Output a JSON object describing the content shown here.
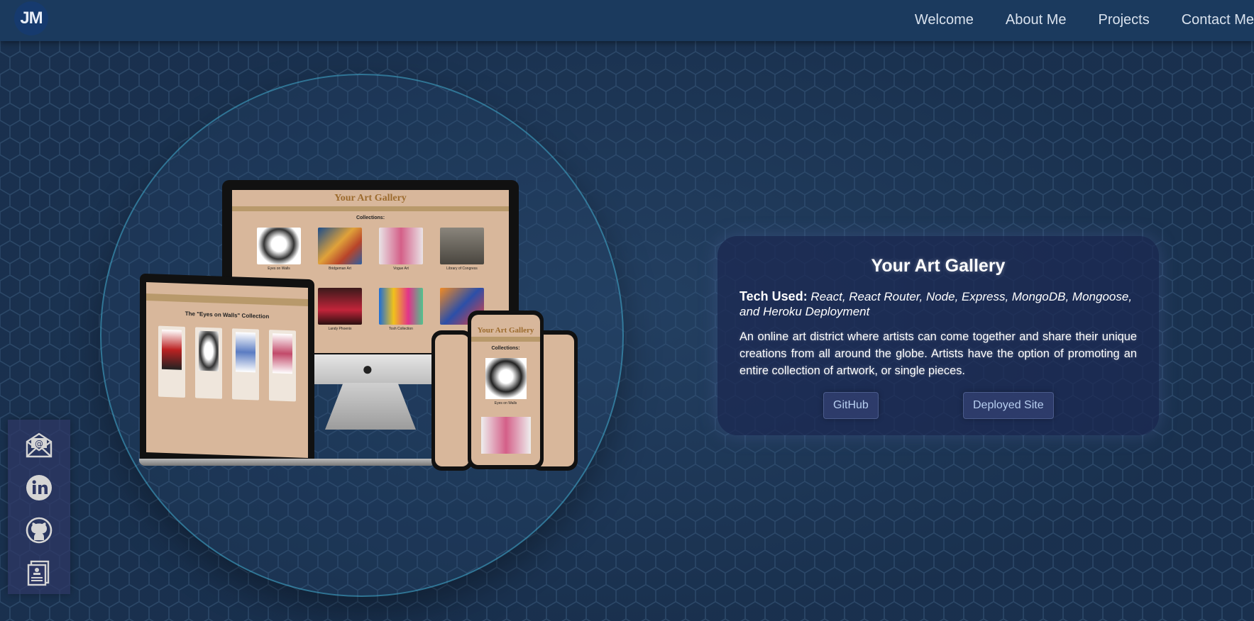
{
  "nav": {
    "logo_text": "JM",
    "links": [
      "Welcome",
      "About Me",
      "Projects",
      "Contact Me"
    ]
  },
  "project": {
    "title": "Your Art Gallery",
    "tech_label": "Tech Used:",
    "tech_list": "React, React Router, Node, Express, MongoDB, Mongoose, and Heroku Deployment",
    "description": "An online art district where artists can come together and share their unique creations from all around the globe. Artists have the option of promoting an entire collection of artwork, or single pieces.",
    "buttons": {
      "github": "GitHub",
      "deployed": "Deployed Site"
    }
  },
  "mockup": {
    "desktop_title": "Your Art Gallery",
    "desktop_subtitle": "Collections:",
    "collections": [
      "Eyes on Walls",
      "Bridgeman Art",
      "Vogue Art",
      "Library of Congress",
      "",
      "Landy Phoenix",
      "Tosh Collection",
      ""
    ],
    "laptop_title": "The \"Eyes on Walls\" Collection",
    "phone_subtitle": "Collections:",
    "phone_item": "Eyes on Walls"
  },
  "sidebar": {
    "icons": [
      "email-icon",
      "linkedin-icon",
      "github-icon",
      "resume-icon"
    ]
  },
  "colors": {
    "background": "#1c3555",
    "navbar": "#1b3a5e",
    "card": "#1c2852",
    "circle_border": "#3faac8",
    "button_text": "#b8cff0",
    "gallery_bg": "#d8b79b"
  }
}
